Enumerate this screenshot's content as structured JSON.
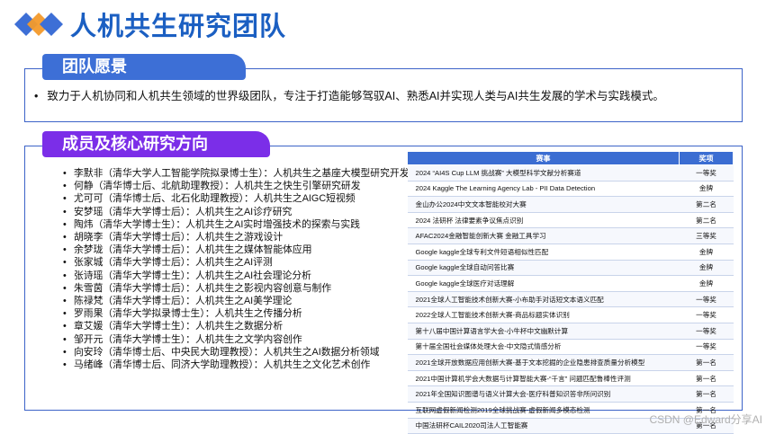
{
  "header": {
    "title": "人机共生研究团队"
  },
  "vision": {
    "heading": "团队愿景",
    "bullet": "致力于人机协同和人机共生领域的世界级团队，专注于打造能够驾驭AI、熟悉AI并实现人类与AI共生发展的学术与实践模式。"
  },
  "members_section": {
    "heading": "成员及核心研究方向",
    "members": [
      "李默非（清华大学人工智能学院拟录博士生）：人机共生之基座大模型研究开发",
      "何静（清华博士后、北航助理教授）：人机共生之快生引擎研究研发",
      "尤可可（清华博士后、北石化助理教授）：人机共生之AIGC短视频",
      "安梦瑶（清华大学博士后）：人机共生之AI诊疗研究",
      "陶炜（清华大学博士生）：人机共生之AI实时增强技术的探索与实践",
      "胡晓李（清华大学博士后）：人机共生之游戏设计",
      "余梦珑（清华大学博士后）：人机共生之媒体智能体应用",
      "张家城（清华大学博士后）：人机共生之AI评测",
      "张诗瑶（清华大学博士生）：人机共生之AI社会理论分析",
      "朱雪茵（清华大学博士后）：人机共生之影视内容创意与制作",
      "陈禄梵（清华大学博士后）：人机共生之AI美学理论",
      "罗雨果（清华大学拟录博士生）：人机共生之传播分析",
      "章艾媛（清华大学博士生）：人机共生之数据分析",
      "邹开元（清华大学博士生）：人机共生之文学内容创作",
      "向安玲（清华博士后、中央民大助理教授）：人机共生之AI数据分析领域",
      "马绪峰（清华博士后、同济大学助理教授）：人机共生之文化艺术创作"
    ]
  },
  "awards_table": {
    "headers": [
      "赛事",
      "奖项"
    ],
    "rows": [
      [
        "2024 “AI4S Cup LLM 挑战赛” 大模型科学文献分析赛道",
        "一等奖"
      ],
      [
        "2024 Kaggle The Learning Agency Lab - PII Data Detection",
        "金牌"
      ],
      [
        "金山办公2024中文文本智能校对大赛",
        "第二名"
      ],
      [
        "2024 法研杯 法律要素争议焦点识别",
        "第二名"
      ],
      [
        "AFAC2024金融智能创新大赛 金融工具学习",
        "三等奖"
      ],
      [
        "Google kaggle全球专利文件短语相似性匹配",
        "金牌"
      ],
      [
        "Google kaggle全球自动问答比赛",
        "金牌"
      ],
      [
        "Google kaggle全球医疗对话理解",
        "金牌"
      ],
      [
        "2021全球人工智能技术创新大赛-小布助手对话短文本语义匹配",
        "一等奖"
      ],
      [
        "2022全球人工智能技术创新大赛-商品标题实体识别",
        "一等奖"
      ],
      [
        "第十八届中国计算语言学大会-小牛杯中文幽默计算",
        "一等奖"
      ],
      [
        "第十届全国社会媒体处理大会-中文隐式情感分析",
        "一等奖"
      ],
      [
        "2021全球开放数据应用创新大赛-基于文本挖掘的企业隐患排查质量分析模型",
        "第一名"
      ],
      [
        "2021中国计算机学会大数据与计算智能大赛-“千言” 问题匹配鲁棒性评测",
        "第一名"
      ],
      [
        "2021年全国知识图谱与语义计算大会-医疗科普知识答非所问识别",
        "第一名"
      ],
      [
        "互联网虚假新闻检测2019全球挑战赛-虚假新闻多模态检测",
        "第一名"
      ],
      [
        "中国法研杯CAIL2020司法人工智能赛",
        "第一名"
      ]
    ]
  },
  "watermark": "CSDN @Edward分享AI",
  "colors": {
    "title_blue": "#1b5fc2",
    "vision_pill": "#3d6fd6",
    "members_pill": "#7b2ee8",
    "table_header": "#3b6dd2",
    "logo_orange": "#f39a2b",
    "logo_blue": "#3d6fd6"
  }
}
